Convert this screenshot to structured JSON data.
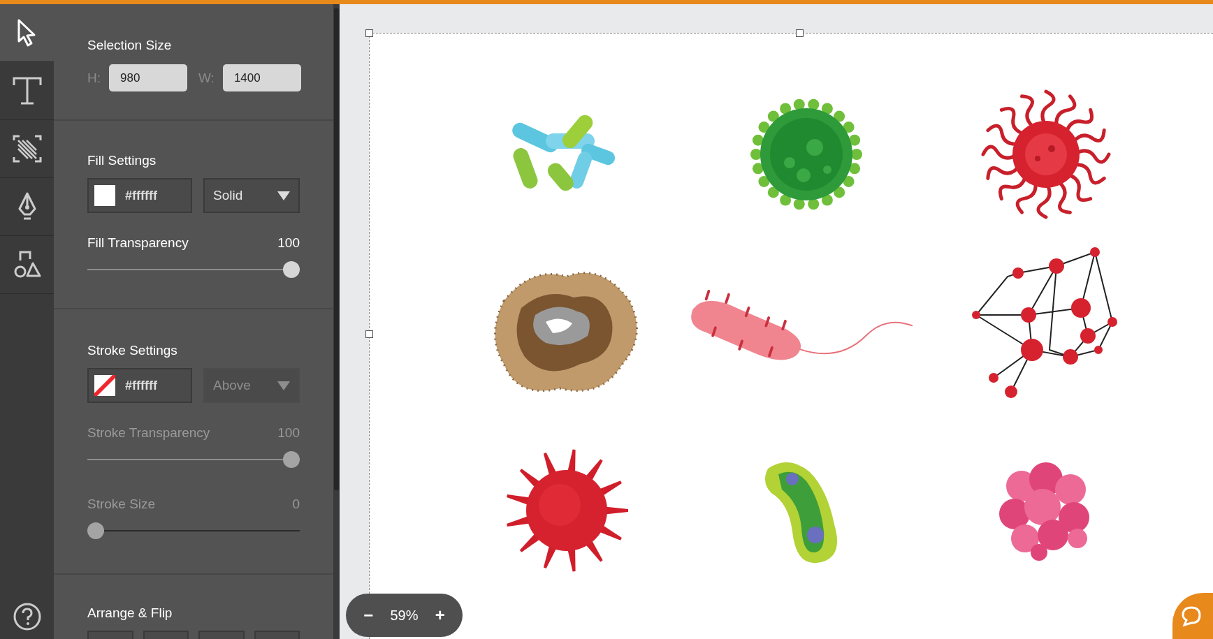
{
  "tools": [
    {
      "selected": true
    },
    {
      "selected": false
    },
    {
      "selected": false
    },
    {
      "selected": false
    },
    {
      "selected": false
    }
  ],
  "selection_size": {
    "title": "Selection Size",
    "height_label": "H:",
    "height_value": "980",
    "width_label": "W:",
    "width_value": "1400"
  },
  "fill_settings": {
    "title": "Fill Settings",
    "swatch": {
      "kind": "solid"
    },
    "color_value": "#ffffff",
    "mode": "Solid",
    "disabled": false
  },
  "fill_transparency": {
    "label": "Fill Transparency",
    "reading": "100",
    "level": 1,
    "disabled": false
  },
  "stroke_settings": {
    "title": "Stroke Settings",
    "swatch": {
      "kind": "none"
    },
    "color_value": "#ffffff",
    "mode": "Above",
    "disabled": true
  },
  "stroke_transparency": {
    "label": "Stroke Transparency",
    "reading": "100",
    "level": 1,
    "disabled": true
  },
  "stroke_size": {
    "label": "Stroke Size",
    "reading": "0",
    "level": 0,
    "disabled": true
  },
  "arrange": {
    "title": "Arrange & Flip"
  },
  "zoom": {
    "minus": "−",
    "value": "59%",
    "plus": "+"
  }
}
